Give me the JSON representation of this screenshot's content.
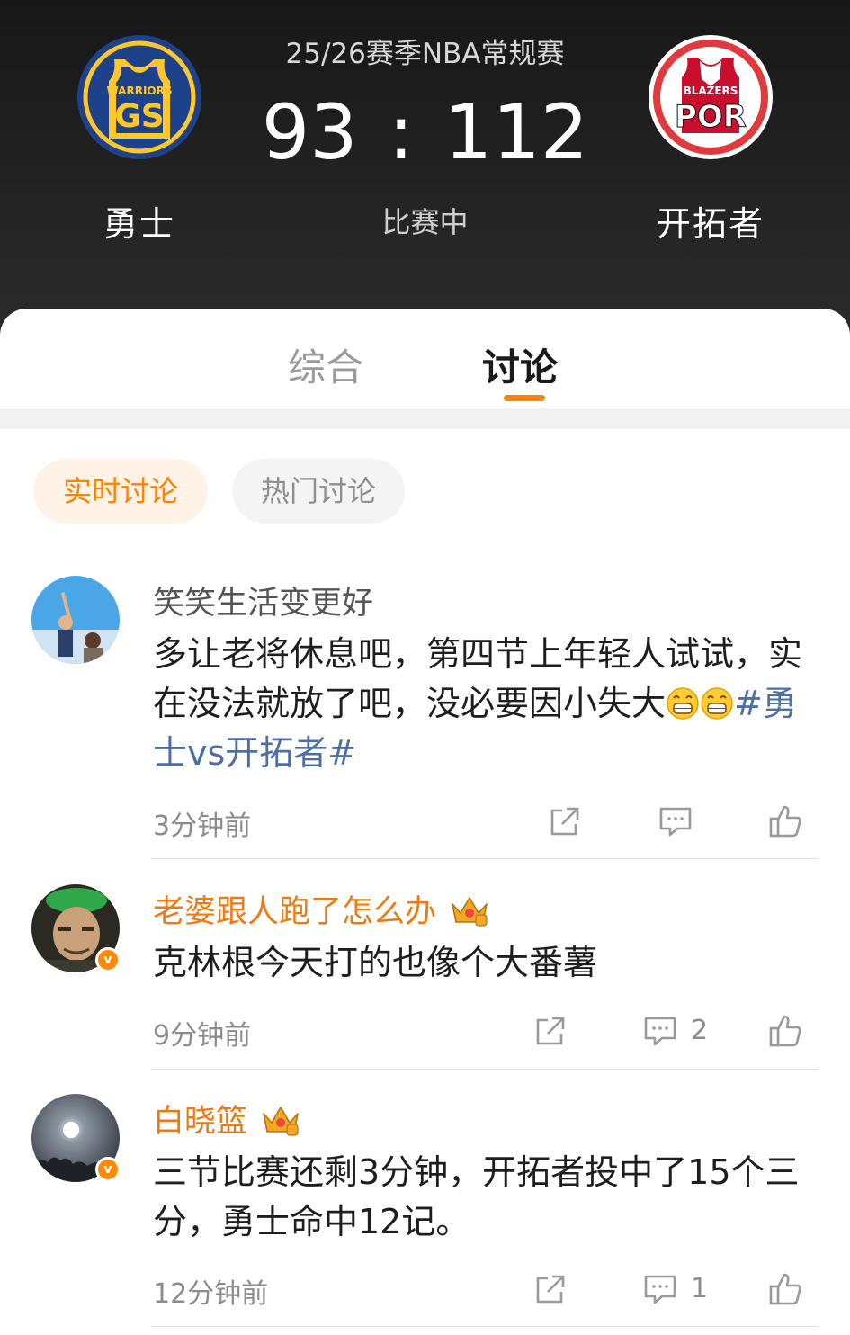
{
  "game": {
    "season": "25/26赛季NBA常规赛",
    "home_team": {
      "name": "勇士",
      "logo_top_text": "WARRIORS",
      "logo_abbr": "GS"
    },
    "away_team": {
      "name": "开拓者",
      "logo_top_text": "BLAZERS",
      "logo_abbr": "POR"
    },
    "home_score": "93",
    "separator": ":",
    "away_score": "112",
    "status": "比赛中"
  },
  "tabs": [
    {
      "label": "综合",
      "active": false
    },
    {
      "label": "讨论",
      "active": true
    }
  ],
  "filters": [
    {
      "label": "实时讨论",
      "active": true
    },
    {
      "label": "热门讨论",
      "active": false
    }
  ],
  "comments": [
    {
      "username": "笑笑生活变更好",
      "text_before": "多让老将休息吧，第四节上年轻人试试，实在没法就放了吧，没必要因小失大",
      "emoji": [
        "grin-emoji",
        "grin-emoji"
      ],
      "hashtag": "#勇士vs开拓者#",
      "time": "3分钟前",
      "reply_count": "",
      "verified": false,
      "crown": false
    },
    {
      "username": "老婆跟人跑了怎么办",
      "text_before": "克林根今天打的也像个大番薯",
      "time": "9分钟前",
      "reply_count": "2",
      "verified": true,
      "crown": true
    },
    {
      "username": "白晓篮",
      "text_before": "三节比赛还剩3分钟，开拓者投中了15个三分，勇士命中12记。",
      "time": "12分钟前",
      "reply_count": "1",
      "verified": true,
      "crown": true
    }
  ],
  "colors": {
    "accent": "#ff8200",
    "hashtag": "#4e6fa3",
    "username_vip": "#f07a12",
    "header_bg": "#1c1c1c",
    "warriors_blue": "#1d428a",
    "warriors_gold": "#ffc72c",
    "blazers_red": "#e03a3e"
  }
}
